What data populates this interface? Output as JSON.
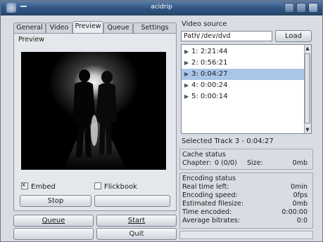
{
  "window": {
    "title": "acidrip"
  },
  "tabs": [
    {
      "label": "General",
      "active": false
    },
    {
      "label": "Video",
      "active": false
    },
    {
      "label": "Preview",
      "active": true
    },
    {
      "label": "Queue",
      "active": false
    },
    {
      "label": "Settings",
      "active": false
    }
  ],
  "preview": {
    "section_label": "Preview",
    "embed": {
      "label": "Embed",
      "checked": true,
      "mark": "x"
    },
    "flickbook": {
      "label": "Flickbook",
      "checked": false
    },
    "stop_label": "Stop"
  },
  "actions": {
    "queue_label": "Queue",
    "start_label": "Start",
    "quit_label": "Quit"
  },
  "video_source": {
    "section_label": "Video source",
    "path_label": "Path",
    "path_value": "/dev/dvd",
    "load_label": "Load",
    "tracks": [
      {
        "label": "1: 2:21:44",
        "selected": false
      },
      {
        "label": "2: 0:56:21",
        "selected": false
      },
      {
        "label": "3: 0:04:27",
        "selected": true
      },
      {
        "label": "4: 0:00:24",
        "selected": false
      },
      {
        "label": "5: 0:00:14",
        "selected": false
      }
    ],
    "selected_track_text": "Selected Track 3 - 0:04:27"
  },
  "cache_status": {
    "section_label": "Cache status",
    "chapter_label": "Chapter:",
    "chapter_value": "0 (0/0)",
    "size_label": "Size:",
    "size_value": "0mb"
  },
  "encoding_status": {
    "section_label": "Encoding status",
    "rows": [
      {
        "label": "Real time left:",
        "value": "0min"
      },
      {
        "label": "Encoding speed:",
        "value": "0fps"
      },
      {
        "label": "Estimated filesize:",
        "value": "0mb"
      },
      {
        "label": "Time encoded:",
        "value": "0:00:00"
      },
      {
        "label": "Average bitrates:",
        "value": "0:0"
      }
    ]
  },
  "colors": {
    "titlebar": "#2f5582",
    "selection": "#a9c6e8",
    "window_bg": "#d9dde3"
  },
  "icons": {
    "window_menu": "app-menu-icon",
    "minimize": "minimize-icon",
    "maximize": "maximize-icon",
    "close": "close-icon"
  }
}
